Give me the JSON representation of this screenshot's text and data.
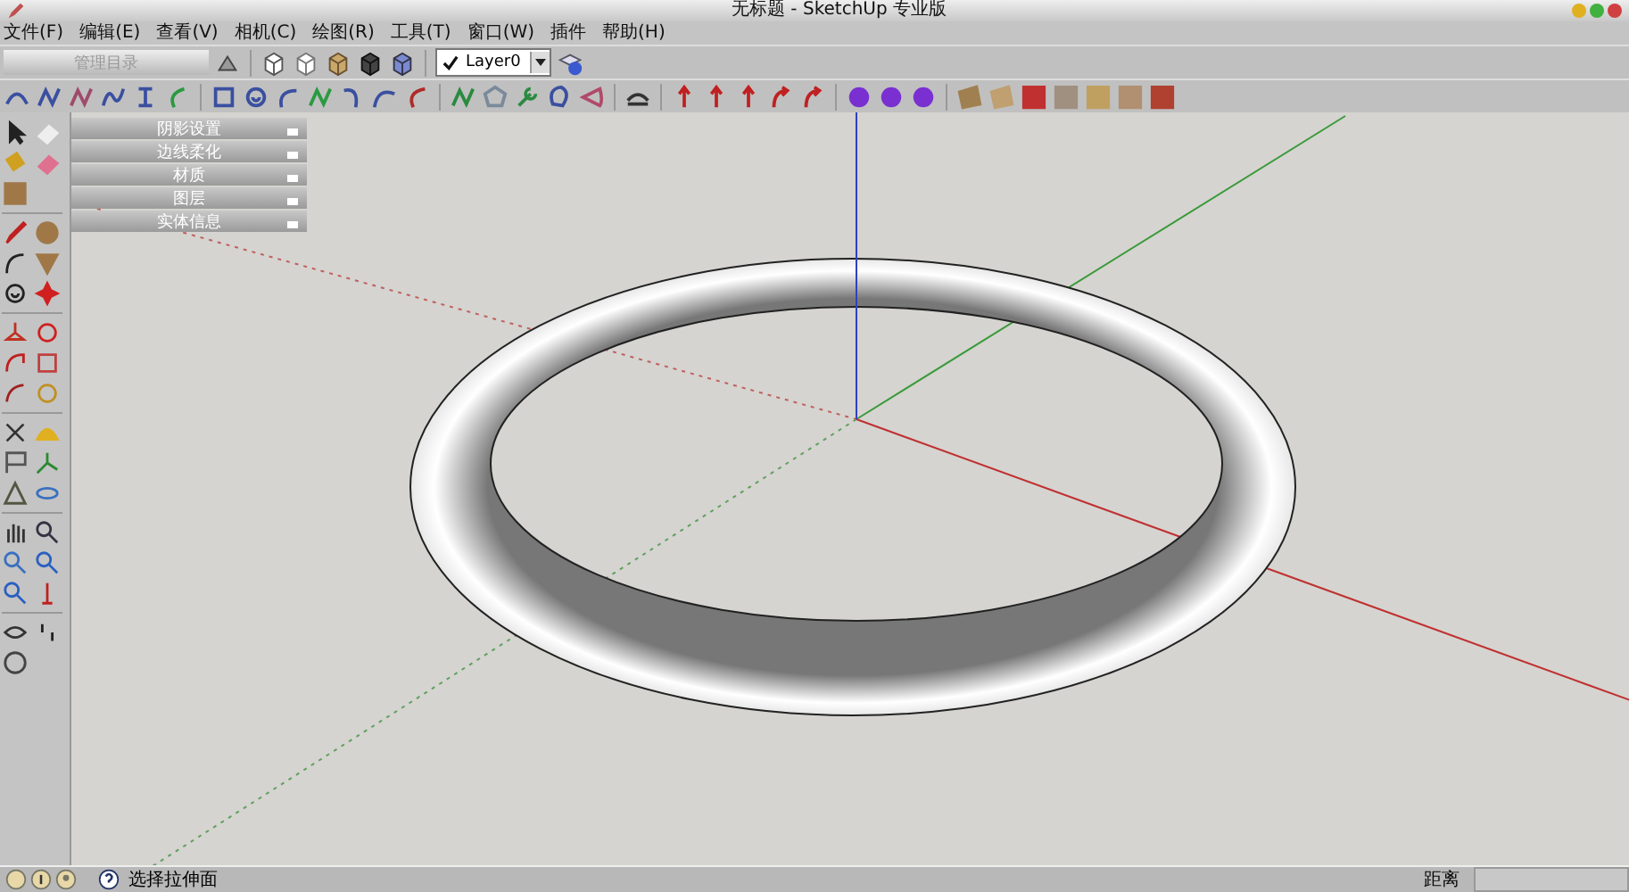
{
  "window": {
    "title": "无标题 - SketchUp 专业版"
  },
  "menu": [
    "文件(F)",
    "编辑(E)",
    "查看(V)",
    "相机(C)",
    "绘图(R)",
    "工具(T)",
    "窗口(W)",
    "插件",
    "帮助(H)"
  ],
  "toolbar": {
    "collapsed_label": "管理目录",
    "layer": {
      "value": "Layer0",
      "current": true
    }
  },
  "trays": [
    {
      "title": "阴影设置",
      "expanded": false
    },
    {
      "title": "边线柔化",
      "expanded": false
    },
    {
      "title": "材质",
      "expanded": false
    },
    {
      "title": "图层",
      "expanded": false
    },
    {
      "title": "实体信息",
      "expanded": false
    }
  ],
  "status_bar": {
    "message": "选择拉伸面",
    "measure_label": "距离"
  }
}
